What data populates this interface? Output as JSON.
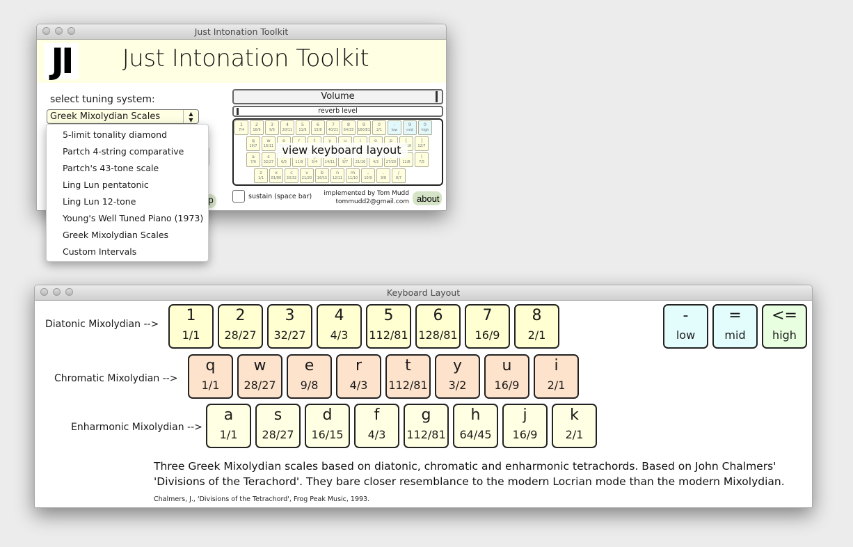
{
  "main_window": {
    "title": "Just Intonation Toolkit",
    "logo_text": "JI",
    "app_title": "Just Intonation Toolkit",
    "tuning_label": "select tuning system:",
    "tuning_selected": "Greek Mixolydian Scales",
    "help_button_partial": "p",
    "volume": {
      "label": "Volume",
      "level_percent": 98
    },
    "reverb": {
      "label": "reverb level",
      "level_percent": 1
    },
    "mini_keyboard": {
      "overlay_label": "view keyboard layout",
      "rows": [
        [
          {
            "key": "1",
            "ratio": "7/4"
          },
          {
            "key": "2",
            "ratio": "16/9"
          },
          {
            "key": "3",
            "ratio": "9/5"
          },
          {
            "key": "4",
            "ratio": "20/11"
          },
          {
            "key": "5",
            "ratio": "11/6"
          },
          {
            "key": "6",
            "ratio": "15/8"
          },
          {
            "key": "7",
            "ratio": "40/21"
          },
          {
            "key": "8",
            "ratio": "64/33"
          },
          {
            "key": "9",
            "ratio": "160/81"
          },
          {
            "key": "0",
            "ratio": "2/1"
          },
          {
            "key": "-",
            "ratio": "low",
            "highlight": true
          },
          {
            "key": "9",
            "ratio": "mid",
            "highlight": true
          },
          {
            "key": "0",
            "ratio": "high",
            "highlight": true
          }
        ],
        [
          {
            "key": "q",
            "ratio": "10/7"
          },
          {
            "key": "w",
            "ratio": "16/11"
          },
          {
            "key": "e",
            "ratio": "40/27"
          },
          {
            "key": "r",
            "ratio": ""
          },
          {
            "key": "t",
            "ratio": ""
          },
          {
            "key": "y",
            "ratio": ""
          },
          {
            "key": "u",
            "ratio": ""
          },
          {
            "key": "i",
            "ratio": ""
          },
          {
            "key": "o",
            "ratio": ""
          },
          {
            "key": "p",
            "ratio": ""
          },
          {
            "key": "[",
            "ratio": "27/16"
          },
          {
            "key": "]",
            "ratio": "12/7"
          }
        ],
        [
          {
            "key": "a",
            "ratio": "7/6"
          },
          {
            "key": "s",
            "ratio": "32/27"
          },
          {
            "key": "d",
            "ratio": "6/5"
          },
          {
            "key": "f",
            "ratio": "11/9"
          },
          {
            "key": "g",
            "ratio": "5/4"
          },
          {
            "key": "h",
            "ratio": "14/11"
          },
          {
            "key": "j",
            "ratio": "9/7"
          },
          {
            "key": "k",
            "ratio": "21/16"
          },
          {
            "key": "l",
            "ratio": "4/3"
          },
          {
            "key": ";",
            "ratio": "27/20"
          },
          {
            "key": "'",
            "ratio": "11/8"
          },
          {
            "key": "\\",
            "ratio": "7/5"
          }
        ],
        [
          {
            "key": "z",
            "ratio": "1/1"
          },
          {
            "key": "x",
            "ratio": "81/80"
          },
          {
            "key": "c",
            "ratio": "33/32"
          },
          {
            "key": "v",
            "ratio": "21/20"
          },
          {
            "key": "b",
            "ratio": "16/15"
          },
          {
            "key": "n",
            "ratio": "12/11"
          },
          {
            "key": "m",
            "ratio": "11/10"
          },
          {
            "key": ",",
            "ratio": "10/9"
          },
          {
            "key": ".",
            "ratio": "9/8"
          },
          {
            "key": "/",
            "ratio": "8/7"
          }
        ]
      ]
    },
    "sustain_label": "sustain (space bar)",
    "credit_line1": "implemented by Tom Mudd",
    "credit_line2": "tommudd2@gmail.com",
    "about_label": "about"
  },
  "dropdown": {
    "options": [
      "5-limit tonality diamond",
      "Partch 4-string comparative",
      "Partch's 43-tone scale",
      "Ling Lun pentatonic",
      "Ling Lun 12-tone",
      "Young's Well Tuned Piano (1973)",
      "Greek Mixolydian Scales",
      "Custom Intervals"
    ]
  },
  "layout_window": {
    "title": "Keyboard Layout",
    "rows": [
      {
        "label": "Diatonic Mixolydian -->",
        "keys": [
          {
            "key": "1",
            "ratio": "1/1"
          },
          {
            "key": "2",
            "ratio": "28/27"
          },
          {
            "key": "3",
            "ratio": "32/27"
          },
          {
            "key": "4",
            "ratio": "4/3"
          },
          {
            "key": "5",
            "ratio": "112/81"
          },
          {
            "key": "6",
            "ratio": "128/81"
          },
          {
            "key": "7",
            "ratio": "16/9"
          },
          {
            "key": "8",
            "ratio": "2/1"
          }
        ]
      },
      {
        "label": "Chromatic Mixolydian -->",
        "keys": [
          {
            "key": "q",
            "ratio": "1/1"
          },
          {
            "key": "w",
            "ratio": "28/27"
          },
          {
            "key": "e",
            "ratio": "9/8"
          },
          {
            "key": "r",
            "ratio": "4/3"
          },
          {
            "key": "t",
            "ratio": "112/81"
          },
          {
            "key": "y",
            "ratio": "3/2"
          },
          {
            "key": "u",
            "ratio": "16/9"
          },
          {
            "key": "i",
            "ratio": "2/1"
          }
        ]
      },
      {
        "label": "Enharmonic Mixolydian -->",
        "keys": [
          {
            "key": "a",
            "ratio": "1/1"
          },
          {
            "key": "s",
            "ratio": "28/27"
          },
          {
            "key": "d",
            "ratio": "16/15"
          },
          {
            "key": "f",
            "ratio": "4/3"
          },
          {
            "key": "g",
            "ratio": "112/81"
          },
          {
            "key": "h",
            "ratio": "64/45"
          },
          {
            "key": "j",
            "ratio": "16/9"
          },
          {
            "key": "k",
            "ratio": "2/1"
          }
        ]
      }
    ],
    "octave_keys": [
      {
        "key": "-",
        "label": "low",
        "selected": false
      },
      {
        "key": "=",
        "label": "mid",
        "selected": false
      },
      {
        "key": "<=",
        "label": "high",
        "selected": true
      }
    ],
    "description": "Three Greek Mixolydian scales based on diatonic, chromatic and enharmonic tetrachords. Based on John Chalmers' 'Divisions of the Terachord'. They bare closer resemblance to the modern Locrian mode than the modern Mixolydian.",
    "citation": "Chalmers, J., 'Divisions of the Tetrachord', Frog Peak Music, 1993."
  },
  "colors": {
    "header_band": "#ffffe3",
    "key_diatonic": "#ffffd2",
    "key_chromatic": "#fde2cc",
    "key_enharmonic": "#ffffe3",
    "key_octave": "#e3fdfd",
    "key_octave_selected": "#e8ffe0",
    "button_green": "#d5e3c6"
  }
}
